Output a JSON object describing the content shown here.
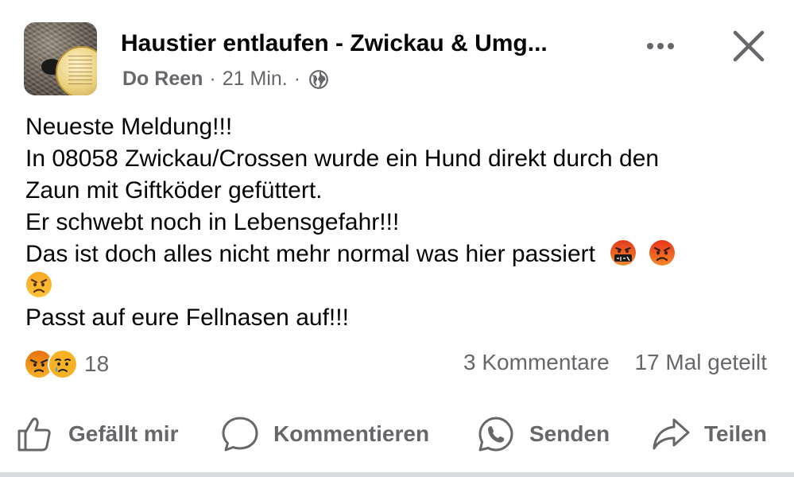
{
  "post": {
    "group_name": "Haustier entlaufen - Zwickau & Umg...",
    "author": "Do Reen",
    "separator": "·",
    "time": "21 Min.",
    "privacy_icon": "globe-icon",
    "lines": [
      "Neueste Meldung!!!",
      "In 08058 Zwickau/Crossen wurde ein Hund direkt durch den",
      "Zaun mit Giftköder gefüttert.",
      "Er schwebt noch in Lebensgefahr!!!",
      "Das ist doch alles nicht mehr normal was hier passiert",
      "Passt auf eure Fellnasen auf!!!"
    ],
    "inline_emojis": [
      "cursing-face-emoji",
      "angry-red-face-emoji",
      "angry-face-emoji"
    ]
  },
  "engagement": {
    "reaction_icons": [
      "angry-reaction-icon",
      "sad-reaction-icon"
    ],
    "reaction_count": "18",
    "comments": "3 Kommentare",
    "shares": "17 Mal geteilt"
  },
  "actions": {
    "like": "Gefällt mir",
    "comment": "Kommentieren",
    "send": "Senden",
    "share": "Teilen"
  },
  "colors": {
    "text": "#050505",
    "secondary": "#65676b",
    "angry_top": "#e9710f",
    "angry_bottom": "#f7b125",
    "sad_yellow": "#f7b125"
  }
}
